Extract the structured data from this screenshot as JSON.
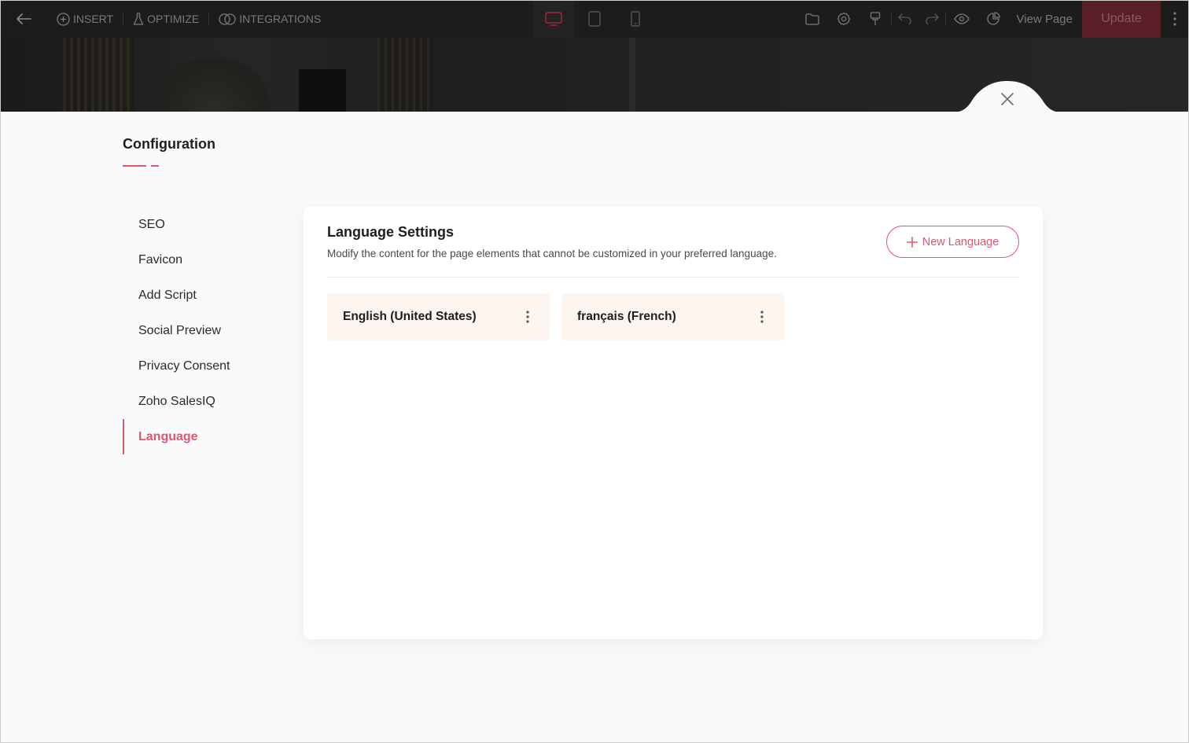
{
  "toolbar": {
    "insert_label": "INSERT",
    "optimize_label": "OPTIMIZE",
    "integrations_label": "INTEGRATIONS",
    "view_page_label": "View Page",
    "update_label": "Update",
    "icons": [
      "back-arrow-icon",
      "plus-circle-icon",
      "flask-icon",
      "link-icon",
      "desktop-icon",
      "tablet-icon",
      "mobile-icon",
      "folder-icon",
      "gear-icon",
      "brush-icon",
      "undo-icon",
      "redo-icon",
      "eye-icon",
      "analytics-icon",
      "more-vertical-icon"
    ],
    "active_device": "desktop",
    "accent_color": "#e0566f"
  },
  "config": {
    "title": "Configuration",
    "nav": [
      {
        "label": "SEO"
      },
      {
        "label": "Favicon"
      },
      {
        "label": "Add Script"
      },
      {
        "label": "Social Preview"
      },
      {
        "label": "Privacy Consent"
      },
      {
        "label": "Zoho SalesIQ"
      },
      {
        "label": "Language"
      }
    ],
    "active_nav": "Language"
  },
  "language_settings": {
    "title": "Language Settings",
    "description": "Modify the content for the page elements that cannot be customized in your preferred language.",
    "new_button_label": "New Language",
    "languages": [
      {
        "name": "English (United States)"
      },
      {
        "name": "français (French)"
      }
    ]
  }
}
